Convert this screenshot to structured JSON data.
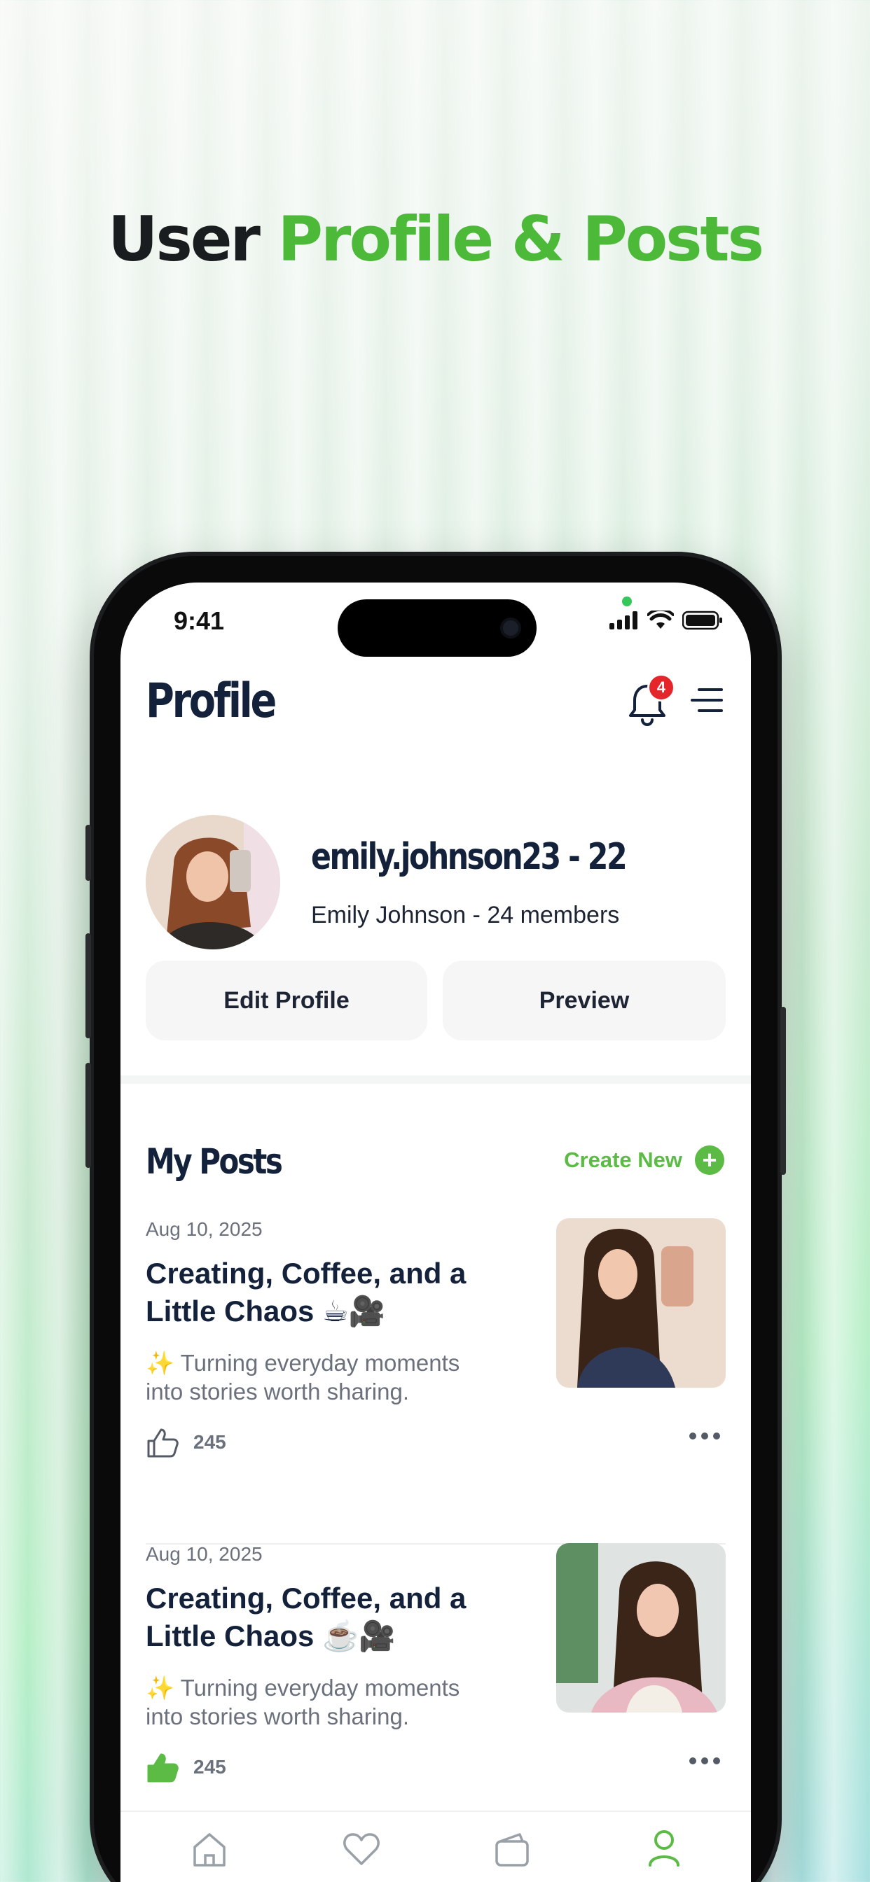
{
  "headline": {
    "part1": "User",
    "part2": "Profile & Posts"
  },
  "colors": {
    "accent": "#5bbb45",
    "badge": "#e5252a",
    "title": "#13223a"
  },
  "status_bar": {
    "time": "9:41",
    "icons": [
      "signal-icon",
      "wifi-icon",
      "battery-icon"
    ]
  },
  "header": {
    "title": "Profile",
    "notification_count": "4",
    "icons": [
      "bell-icon",
      "menu-icon"
    ]
  },
  "profile": {
    "username": "emily.johnson23 - 22",
    "subtitle": "Emily Johnson - 24 members",
    "edit_label": "Edit Profile",
    "preview_label": "Preview"
  },
  "posts_section": {
    "title": "My Posts",
    "create_label": "Create New",
    "posts": [
      {
        "date": "Aug 10, 2025",
        "title": "Creating, Coffee, and a Little Chaos ☕🎥",
        "description": "✨ Turning everyday moments into stories worth sharing.",
        "likes": "245",
        "liked": false
      },
      {
        "date": "Aug 10, 2025",
        "title": "Creating, Coffee, and a Little Chaos ☕🎥",
        "description": "✨ Turning everyday moments into stories worth sharing.",
        "likes": "245",
        "liked": true
      }
    ]
  },
  "tabbar": {
    "tabs": [
      {
        "icon": "home-icon",
        "label": "Home"
      },
      {
        "icon": "heart-icon",
        "label": "Favorites"
      },
      {
        "icon": "wallet-icon",
        "label": "Wallet"
      },
      {
        "icon": "profile-icon",
        "label": "Profile",
        "active": true
      }
    ]
  }
}
